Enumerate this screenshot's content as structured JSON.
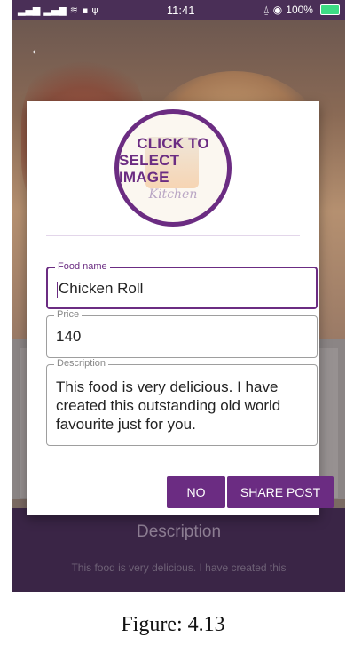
{
  "status_bar": {
    "signals": "..ıl ..ıl",
    "time": "11:41",
    "battery": "100%"
  },
  "background": {
    "description_title": "Description",
    "description_text": "This food is very delicious. I have created this"
  },
  "dialog": {
    "image_picker": {
      "line1": "CLICK TO",
      "line2": "SELECT IMAGE",
      "brand": "Kitchen"
    },
    "fields": {
      "food_name": {
        "label": "Food name",
        "value": "Chicken Roll"
      },
      "price": {
        "label": "Price",
        "value": "140"
      },
      "description": {
        "label": "Description",
        "value": "This food is very delicious. I have created this outstanding old world favourite just for you."
      }
    },
    "buttons": {
      "no": "NO",
      "share": "SHARE POST"
    }
  },
  "caption": "Figure: 4.13",
  "colors": {
    "accent": "#6b2c82",
    "status_bar": "#4a2f57",
    "battery": "#3ddc84"
  }
}
